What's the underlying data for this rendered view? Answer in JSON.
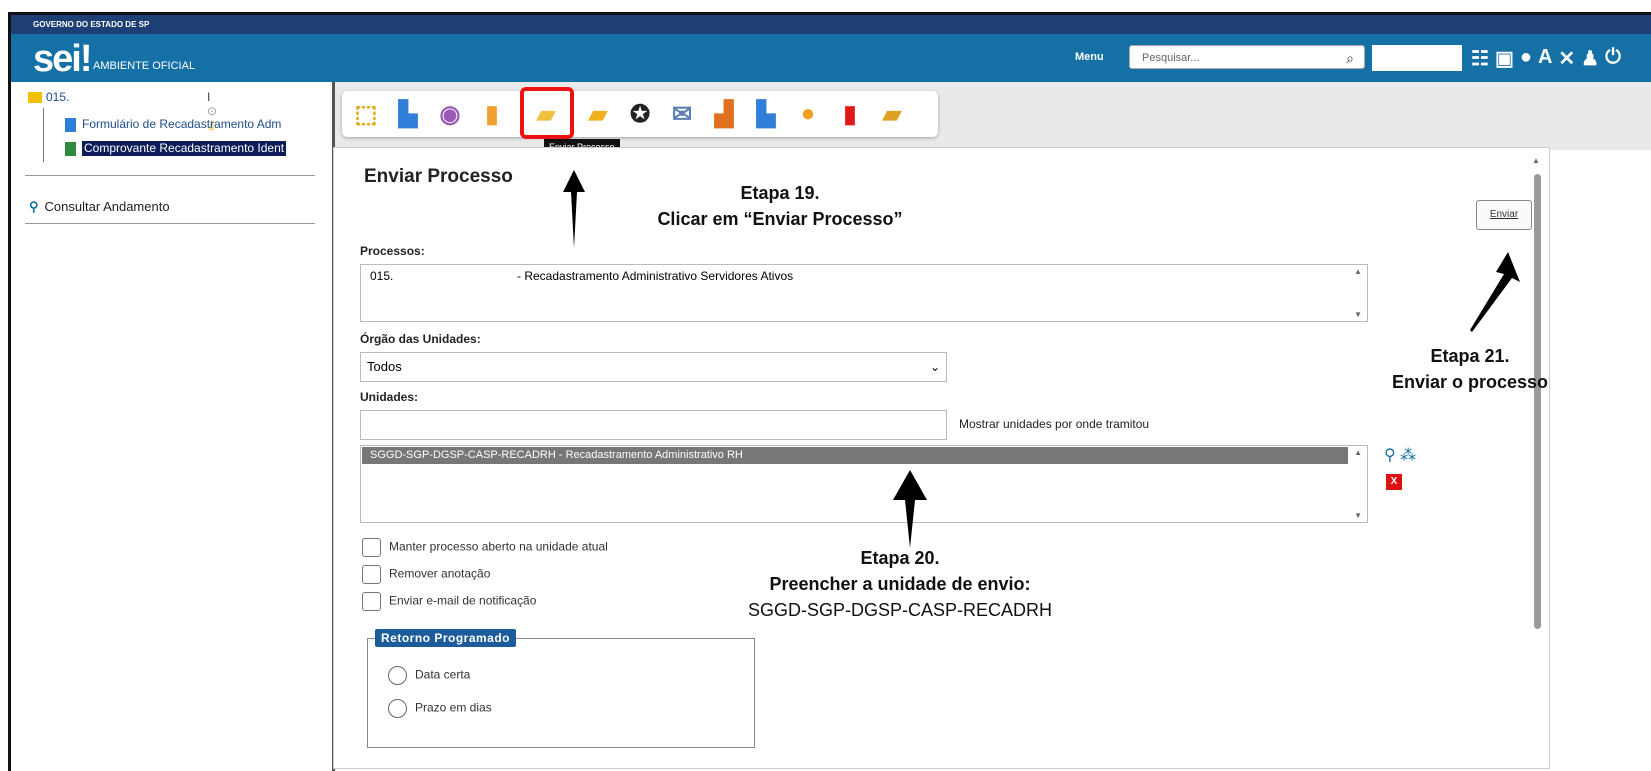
{
  "gov_bar": {
    "text": "GOVERNO DO ESTADO DE SP"
  },
  "header": {
    "logo": "sei",
    "logo_bang": "!",
    "ambiente": "AMBIENTE OFICIAL",
    "menu": "Menu",
    "search_placeholder": "Pesquisar...",
    "icons": [
      "grid-list-icon",
      "calendar-icon",
      "globe-icon",
      "font-size-icon",
      "tools-icon",
      "user-icon",
      "power-icon"
    ]
  },
  "tree": {
    "root_label": "015.",
    "root_marks": "I",
    "items": [
      {
        "label": "Formulário de Recadastramento Adm"
      },
      {
        "label": "Comprovante Recadastramento Ident"
      }
    ],
    "consult": "Consultar Andamento"
  },
  "toolbar": {
    "tooltip": "Enviar Processo",
    "buttons": [
      "new-document-icon",
      "document-settings-icon",
      "view-icon",
      "permissions-icon",
      "enviar-processo-icon",
      "folder-info-icon",
      "badge-check-icon",
      "email-icon",
      "export-icon",
      "document-star-icon",
      "comment-icon",
      "trash-icon",
      "folder-close-icon"
    ]
  },
  "form": {
    "title": "Enviar Processo",
    "enviar": "Enviar",
    "processos_label": "Processos:",
    "processos_num": "015.",
    "processos_desc": "- Recadastramento Administrativo Servidores Ativos",
    "orgao_label": "Órgão das Unidades:",
    "orgao_value": "Todos",
    "unidades_label": "Unidades:",
    "mostrar": "Mostrar unidades por onde tramitou",
    "selected_unit": "SGGD-SGP-DGSP-CASP-RECADRH - Recadastramento Administrativo RH",
    "checkboxes": [
      "Manter processo aberto na unidade atual",
      "Remover anotação",
      "Enviar e-mail de notificação"
    ],
    "retorno_legend": "Retorno Programado",
    "radios": [
      "Data certa",
      "Prazo em dias"
    ]
  },
  "annotations": {
    "etapa19_a": "Etapa 19.",
    "etapa19_b": "Clicar em “Enviar Processo”",
    "etapa20_a": "Etapa 20.",
    "etapa20_b": "Preencher a unidade de envio:",
    "etapa20_c": "SGGD-SGP-DGSP-CASP-RECADRH",
    "etapa21_a": "Etapa 21.",
    "etapa21_b": "Enviar o processo"
  }
}
